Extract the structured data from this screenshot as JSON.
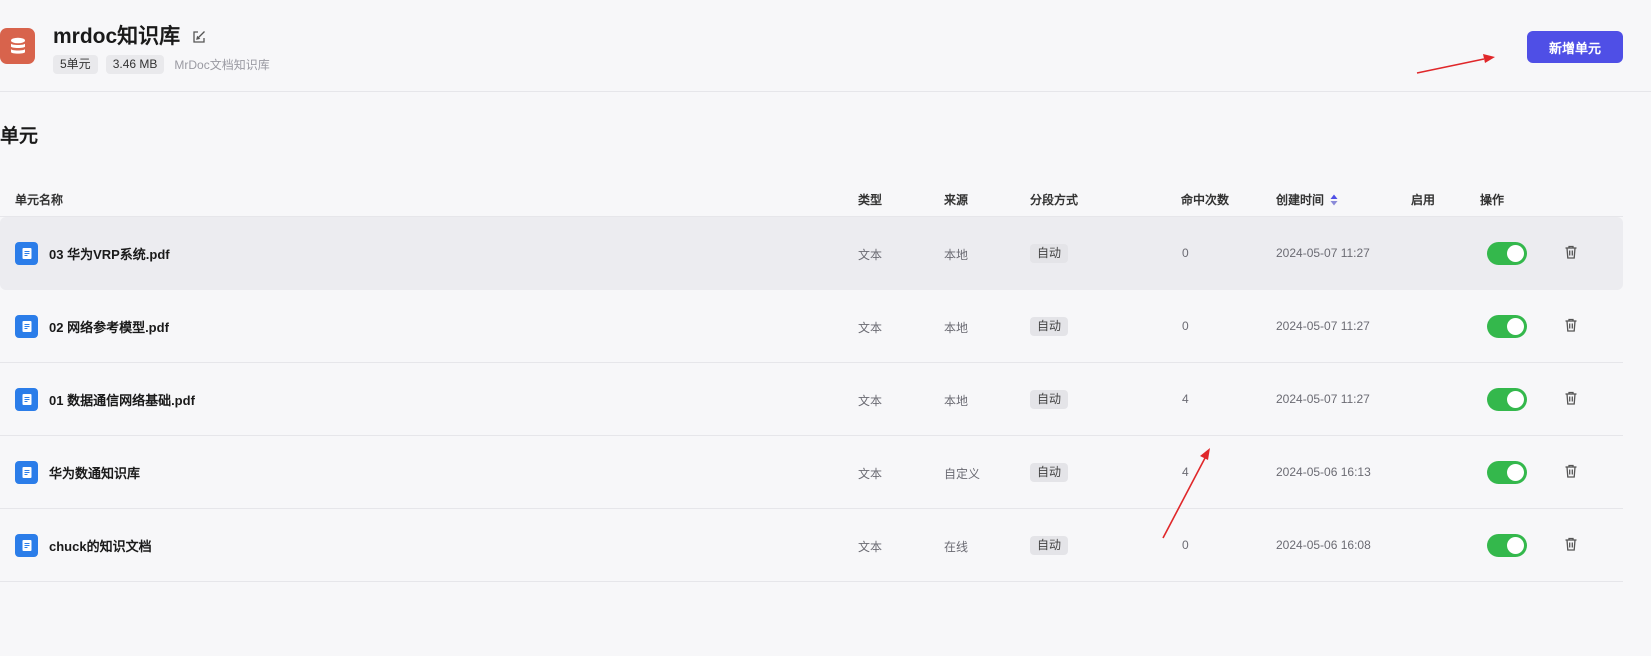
{
  "knowledge_base": {
    "title": "mrdoc知识库",
    "unit_count": "5单元",
    "size": "3.46 MB",
    "description": "MrDoc文档知识库",
    "add_button": "新增单元"
  },
  "section_title": "单元",
  "table": {
    "columns": [
      "单元名称",
      "类型",
      "来源",
      "分段方式",
      "命中次数",
      "创建时间",
      "启用",
      "操作"
    ],
    "sort_column": "创建时间",
    "rows": [
      {
        "name": "03 华为VRP系统.pdf",
        "type": "文本",
        "source": "本地",
        "segment": "自动",
        "hits": "0",
        "created": "2024-05-07 11:27",
        "enabled": true
      },
      {
        "name": "02 网络参考模型.pdf",
        "type": "文本",
        "source": "本地",
        "segment": "自动",
        "hits": "0",
        "created": "2024-05-07 11:27",
        "enabled": true
      },
      {
        "name": "01 数据通信网络基础.pdf",
        "type": "文本",
        "source": "本地",
        "segment": "自动",
        "hits": "4",
        "created": "2024-05-07 11:27",
        "enabled": true
      },
      {
        "name": "华为数通知识库",
        "type": "文本",
        "source": "自定义",
        "segment": "自动",
        "hits": "4",
        "created": "2024-05-06 16:13",
        "enabled": true
      },
      {
        "name": "chuck的知识文档",
        "type": "文本",
        "source": "在线",
        "segment": "自动",
        "hits": "0",
        "created": "2024-05-06 16:08",
        "enabled": true
      }
    ]
  },
  "colors": {
    "primary": "#4f4fe6",
    "toggle_on": "#34b84c",
    "file_icon": "#2b7de9",
    "kb_icon": "#d8634c",
    "annotation_arrow": "#e0272a"
  }
}
